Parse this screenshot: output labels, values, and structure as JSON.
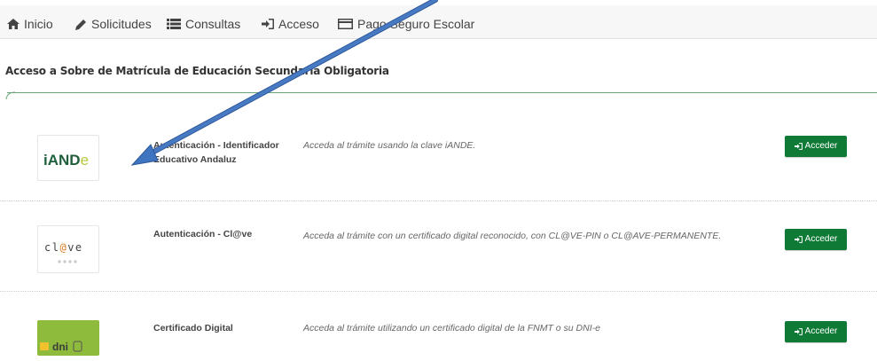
{
  "nav": {
    "items": [
      {
        "label": "Inicio",
        "icon": "home-icon"
      },
      {
        "label": "Solicitudes",
        "icon": "pencil-icon"
      },
      {
        "label": "Consultas",
        "icon": "list-icon"
      },
      {
        "label": "Acceso",
        "icon": "login-icon"
      },
      {
        "label": "Pago Seguro Escolar",
        "icon": "credit-card-icon"
      }
    ]
  },
  "section": {
    "title": "Acceso a Sobre de Matrícula de Educación Secundaria Obligatoria"
  },
  "methods": [
    {
      "logo_text": "iANDe",
      "title": "Autenticación - Identificador Educativo Andaluz",
      "description": "Acceda al trámite usando la clave iANDE.",
      "button": "Acceder"
    },
    {
      "logo_text": "cl@ve",
      "title": "Autenticación - Cl@ve",
      "description": "Acceda al trámite con un certificado digital reconocido, con CL@VE-PIN o CL@AVE-PERMANENTE.",
      "button": "Acceder"
    },
    {
      "logo_text": "dni",
      "title": "Certificado Digital",
      "description": "Acceda al trámite utilizando un certificado digital de la FNMT o su DNI-e",
      "button": "Acceder"
    }
  ],
  "colors": {
    "accent_green": "#0f7a36",
    "arrow_blue": "#3f74c0",
    "section_line": "#6aa57a"
  }
}
